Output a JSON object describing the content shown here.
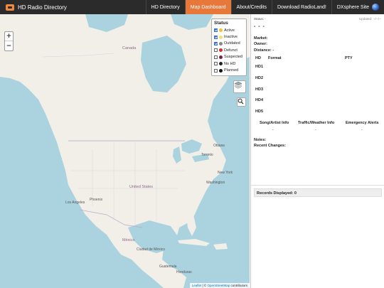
{
  "nav": {
    "brand": "HD Radio Directory",
    "links": [
      "HD Directory",
      "Map Dashboard",
      "About/Credits",
      "Download RadioLand!",
      "DXsphere Site"
    ]
  },
  "map": {
    "zoom_in": "+",
    "zoom_out": "−",
    "labels": {
      "canada": "Canada",
      "ottawa": "Ottawa",
      "toronto": "Toronto",
      "new_york": "New York",
      "washington": "Washington",
      "united_states": "United States",
      "los_angeles": "Los Angeles",
      "phoenix": "Phoenix",
      "mexico": "México",
      "ciudad_de_mexico": "Ciudad de México",
      "guatemala": "Guatemala",
      "honduras": "Honduras"
    },
    "legend": {
      "title": "Status",
      "items": [
        {
          "label": "Active",
          "checked": true,
          "color": "#f2c230"
        },
        {
          "label": "Inactive",
          "checked": true,
          "color": "#f5e06b"
        },
        {
          "label": "Outdated",
          "checked": true,
          "color": "#888888"
        },
        {
          "label": "Defunct",
          "checked": false,
          "color": "#d32f2f"
        },
        {
          "label": "Suspected",
          "checked": false,
          "color": "#7b1f3a"
        },
        {
          "label": "No HD",
          "checked": false,
          "color": "#222222"
        },
        {
          "label": "Planned",
          "checked": false,
          "color": "#111111"
        }
      ]
    },
    "attribution": {
      "leaflet": "Leaflet",
      "sep": " | © ",
      "osm": "OpenStreetMap",
      "tail": " contributors"
    }
  },
  "panel": {
    "status": "Status: -",
    "updated": "Updated: --/--/--",
    "dashes": "- - -",
    "market": "Market:",
    "owner": "Owner:",
    "distance": "Distance: -",
    "hd_col": "HD",
    "format_col": "Format",
    "pty_col": "PTY",
    "hd_rows": [
      "HD1",
      "HD2",
      "HD3",
      "HD4",
      "HD5"
    ],
    "features": [
      "Song/Artist Info",
      "Traffic/Weather Info",
      "Emergency Alerts"
    ],
    "feature_values": [
      "-",
      "-",
      "-"
    ],
    "notes": "Notes:",
    "recent": "Recent Changes:",
    "records": "Records Displayed: 0"
  },
  "colors": {
    "nav_bg": "#2b2b2b",
    "nav_active": "#e8773a",
    "water": "#aad3df",
    "land": "#f2efe9"
  }
}
